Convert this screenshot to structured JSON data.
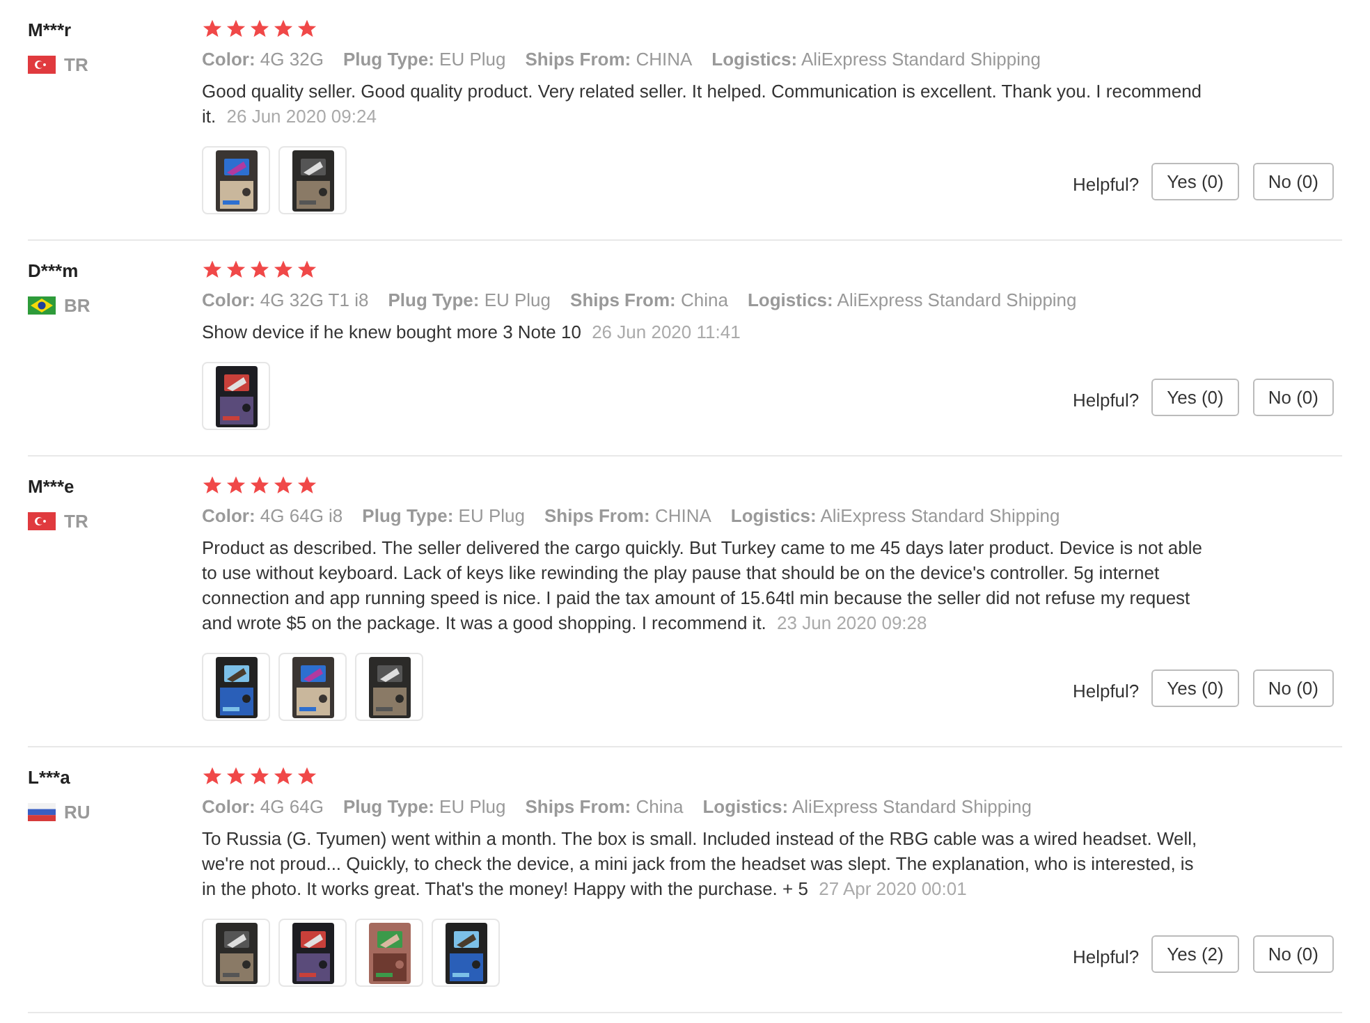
{
  "reviews": [
    {
      "user": "M***r",
      "flag": {
        "kind": "turkey"
      },
      "country": "TR",
      "stars": 5,
      "attributes": [
        {
          "label": "Color:",
          "value": "4G 32G"
        },
        {
          "label": "Plug Type:",
          "value": "EU Plug"
        },
        {
          "label": "Ships From:",
          "value": "CHINA"
        },
        {
          "label": "Logistics:",
          "value": "AliExpress Standard Shipping"
        }
      ],
      "text": "Good quality seller. Good quality product. Very related seller. It helped. Communication is excellent. Thank you. I recommend it.",
      "date": "26 Jun 2020 09:24",
      "photos": [
        {
          "kind": "picture"
        },
        {
          "kind": "picture"
        }
      ],
      "helpful": "Helpful?",
      "yes": "Yes (0)",
      "no": "No (0)"
    },
    {
      "user": "D***m",
      "flag": {
        "kind": "brazil"
      },
      "country": "BR",
      "stars": 5,
      "attributes": [
        {
          "label": "Color:",
          "value": "4G 32G T1 i8"
        },
        {
          "label": "Plug Type:",
          "value": "EU Plug"
        },
        {
          "label": "Ships From:",
          "value": "China"
        },
        {
          "label": "Logistics:",
          "value": "AliExpress Standard Shipping"
        }
      ],
      "text": "Show device if he knew bought more 3 Note 10",
      "date": "26 Jun 2020 11:41",
      "photos": [
        {
          "kind": "picture"
        }
      ],
      "helpful": "Helpful?",
      "yes": "Yes (0)",
      "no": "No (0)"
    },
    {
      "user": "M***e",
      "flag": {
        "kind": "turkey"
      },
      "country": "TR",
      "stars": 5,
      "attributes": [
        {
          "label": "Color:",
          "value": "4G 64G i8"
        },
        {
          "label": "Plug Type:",
          "value": "EU Plug"
        },
        {
          "label": "Ships From:",
          "value": "CHINA"
        },
        {
          "label": "Logistics:",
          "value": "AliExpress Standard Shipping"
        }
      ],
      "text": "Product as described. The seller delivered the cargo quickly. But Turkey came to me 45 days later product. Device is not able to use without keyboard. Lack of keys like rewinding the play pause that should be on the device's controller. 5g internet connection and app running speed is nice. I paid the tax amount of 15.64tl min because the seller did not refuse my request and wrote $5 on the package. It was a good shopping. I recommend it.",
      "date": "23 Jun 2020 09:28",
      "photos": [
        {
          "kind": "picture"
        },
        {
          "kind": "picture"
        },
        {
          "kind": "picture"
        }
      ],
      "helpful": "Helpful?",
      "yes": "Yes (0)",
      "no": "No (0)"
    },
    {
      "user": "L***a",
      "flag": {
        "kind": "russia"
      },
      "country": "RU",
      "stars": 5,
      "attributes": [
        {
          "label": "Color:",
          "value": "4G 64G"
        },
        {
          "label": "Plug Type:",
          "value": "EU Plug"
        },
        {
          "label": "Ships From:",
          "value": "China"
        },
        {
          "label": "Logistics:",
          "value": "AliExpress Standard Shipping"
        }
      ],
      "text": "To Russia (G. Tyumen) went within a month. The box is small. Included instead of the RBG cable was a wired headset. Well, we're not proud... Quickly, to check the device, a mini jack from the headset was slept. The explanation, who is interested, is in the photo. It works great. That's the money! Happy with the purchase. + 5",
      "date": "27 Apr 2020 00:01",
      "photos": [
        {
          "kind": "picture"
        },
        {
          "kind": "picture"
        },
        {
          "kind": "picture"
        },
        {
          "kind": "picture"
        }
      ],
      "helpful": "Helpful?",
      "yes": "Yes (2)",
      "no": "No (0)"
    }
  ]
}
